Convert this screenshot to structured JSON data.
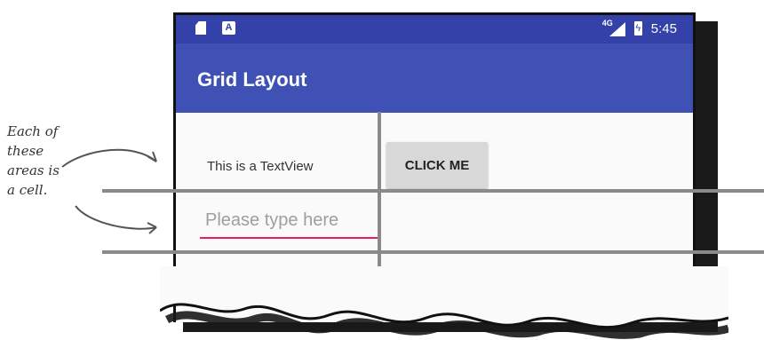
{
  "status_bar": {
    "network_label": "4G",
    "time": "5:45",
    "icons": [
      "sd-card-icon",
      "a-icon",
      "network-icon",
      "battery-icon"
    ]
  },
  "app_bar": {
    "title": "Grid Layout"
  },
  "content": {
    "textview_text": "This is a TextView",
    "button_label": "CLICK ME",
    "edittext_placeholder": "Please type here"
  },
  "annotation": {
    "lines": [
      "Each of",
      "these",
      "areas is",
      "a cell."
    ]
  },
  "colors": {
    "status_bar": "#3341a8",
    "app_bar": "#3f51b5",
    "accent": "#e91e63",
    "grid_lines": "#8a8a8a"
  }
}
